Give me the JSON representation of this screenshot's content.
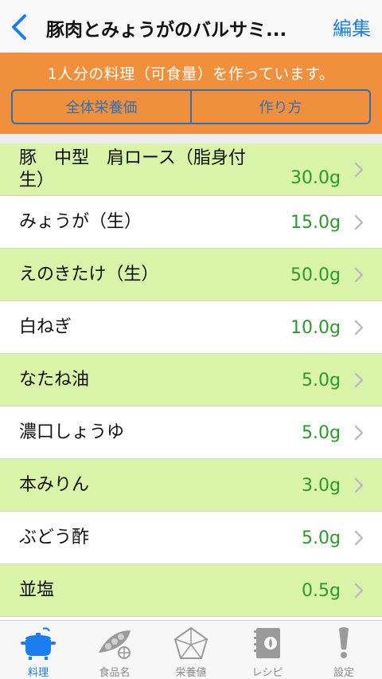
{
  "navbar": {
    "title": "豚肉とみょうがのバルサミ...",
    "edit_label": "編集"
  },
  "banner": {
    "text": "1人分の料理（可食量）を作っています。",
    "segments": [
      "全体栄養価",
      "作り方"
    ]
  },
  "ingredients": [
    {
      "name": "豚　中型　肩ロース（脂身付生）",
      "amount": "30.0g"
    },
    {
      "name": "みょうが（生）",
      "amount": "15.0g"
    },
    {
      "name": "えのきたけ（生）",
      "amount": "50.0g"
    },
    {
      "name": "白ねぎ",
      "amount": "10.0g"
    },
    {
      "name": "なたね油",
      "amount": "5.0g"
    },
    {
      "name": "濃口しょうゆ",
      "amount": "5.0g"
    },
    {
      "name": "本みりん",
      "amount": "3.0g"
    },
    {
      "name": "ぶどう酢",
      "amount": "5.0g"
    },
    {
      "name": "並塩",
      "amount": "0.5g"
    }
  ],
  "tabs": [
    {
      "label": "料理",
      "icon": "pot-icon",
      "active": true
    },
    {
      "label": "食品名",
      "icon": "peas-icon",
      "active": false
    },
    {
      "label": "栄養値",
      "icon": "pentagon-icon",
      "active": false
    },
    {
      "label": "レシピ",
      "icon": "notebook-icon",
      "active": false
    },
    {
      "label": "設定",
      "icon": "exclamation-icon",
      "active": false
    }
  ],
  "colors": {
    "accent": "#1a7ef0",
    "banner": "#f0903c",
    "row_alt": "#d9f4a8",
    "amount": "#2a9a2a"
  }
}
